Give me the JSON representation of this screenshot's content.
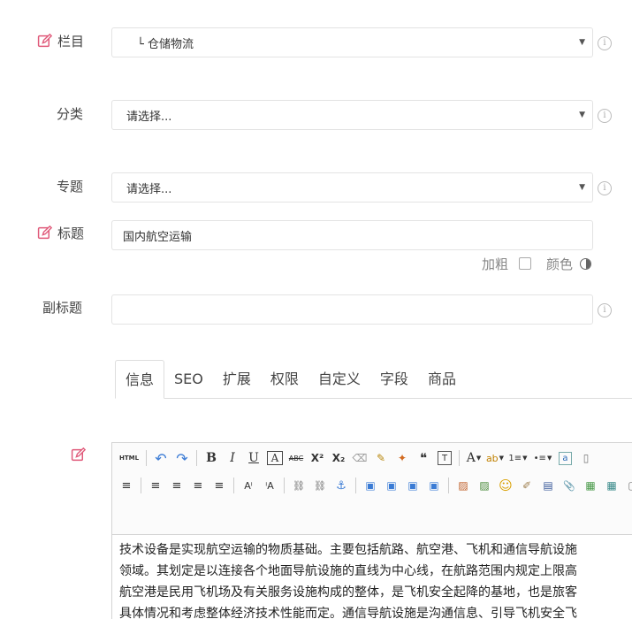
{
  "form": {
    "column": {
      "label": "栏目",
      "value": "└ 仓储物流"
    },
    "category": {
      "label": "分类",
      "value": "请选择..."
    },
    "topic": {
      "label": "专题",
      "value": "请选择..."
    },
    "title": {
      "label": "标题",
      "value": "国内航空运输",
      "bold_label": "加粗",
      "color_label": "颜色"
    },
    "subtitle": {
      "label": "副标题",
      "value": ""
    },
    "info_glyph": "i"
  },
  "tabs": [
    {
      "label": "信息",
      "active": true
    },
    {
      "label": "SEO"
    },
    {
      "label": "扩展"
    },
    {
      "label": "权限"
    },
    {
      "label": "自定义"
    },
    {
      "label": "字段"
    },
    {
      "label": "商品"
    }
  ],
  "editor": {
    "toolbar_row1": [
      {
        "name": "source-html-button",
        "text": "HTML"
      },
      {
        "name": "undo-icon",
        "text": "↶"
      },
      {
        "name": "redo-icon",
        "text": "↷"
      },
      {
        "name": "bold-icon",
        "text": "B"
      },
      {
        "name": "italic-icon",
        "text": "I"
      },
      {
        "name": "underline-icon",
        "text": "U"
      },
      {
        "name": "font-border-icon",
        "text": "A"
      },
      {
        "name": "strikethrough-icon",
        "text": "ABC"
      },
      {
        "name": "superscript-icon",
        "text": "X²"
      },
      {
        "name": "subscript-icon",
        "text": "X₂"
      },
      {
        "name": "eraser-icon",
        "text": "⌫"
      },
      {
        "name": "format-brush-icon",
        "text": "✎"
      },
      {
        "name": "auto-format-icon",
        "text": "✦"
      },
      {
        "name": "blockquote-icon",
        "text": "❝"
      },
      {
        "name": "paste-plain-icon",
        "text": "T"
      },
      {
        "name": "font-color-icon",
        "text": "A"
      },
      {
        "name": "highlight-color-icon",
        "text": "ab"
      },
      {
        "name": "ordered-list-icon",
        "text": "1≡"
      },
      {
        "name": "unordered-list-icon",
        "text": "•≡"
      },
      {
        "name": "select-all-icon",
        "text": "a"
      },
      {
        "name": "clear-doc-icon",
        "text": "▯"
      }
    ],
    "toolbar_row2": [
      {
        "name": "row-spacing-icon",
        "text": "≡"
      },
      {
        "name": "align-left-icon",
        "text": "≡"
      },
      {
        "name": "align-center-icon",
        "text": "≡"
      },
      {
        "name": "align-right-icon",
        "text": "≡"
      },
      {
        "name": "align-justify-icon",
        "text": "≡"
      },
      {
        "name": "text-direction-ltr-icon",
        "text": "Aⁱ"
      },
      {
        "name": "text-direction-rtl-icon",
        "text": "ⁱA"
      },
      {
        "name": "link-icon",
        "text": "⛓"
      },
      {
        "name": "unlink-icon",
        "text": "⛓"
      },
      {
        "name": "anchor-icon",
        "text": "⚓"
      },
      {
        "name": "image-none-icon",
        "text": "▣"
      },
      {
        "name": "image-left-icon",
        "text": "▣"
      },
      {
        "name": "image-right-icon",
        "text": "▣"
      },
      {
        "name": "image-center-icon",
        "text": "▣"
      },
      {
        "name": "simple-upload-icon",
        "text": "▨"
      },
      {
        "name": "insert-image-icon",
        "text": "▨"
      },
      {
        "name": "emotion-icon",
        "text": "☺"
      },
      {
        "name": "scrawl-icon",
        "text": "✐"
      },
      {
        "name": "insert-video-icon",
        "text": "▤"
      },
      {
        "name": "attachment-icon",
        "text": "📎"
      },
      {
        "name": "map-icon",
        "text": "▦"
      },
      {
        "name": "gmap-icon",
        "text": "▦"
      },
      {
        "name": "frame-icon",
        "text": "▢"
      }
    ],
    "content_lines": [
      "技术设备是实现航空运输的物质基础。主要包括航路、航空港、飞机和通信导航设施",
      "领域。其划定是以连接各个地面导航设施的直线为中心线，在航路范围内规定上限高",
      "航空港是民用飞机场及有关服务设施构成的整体，是飞机安全起降的基地，也是旅客",
      "具体情况和考虑整体经济技术性能而定。通信导航设施是沟通信息、引导飞机安全飞"
    ]
  },
  "colors": {
    "edit_icon": "#e05a7a",
    "link_blue": "#3a7bd5"
  }
}
